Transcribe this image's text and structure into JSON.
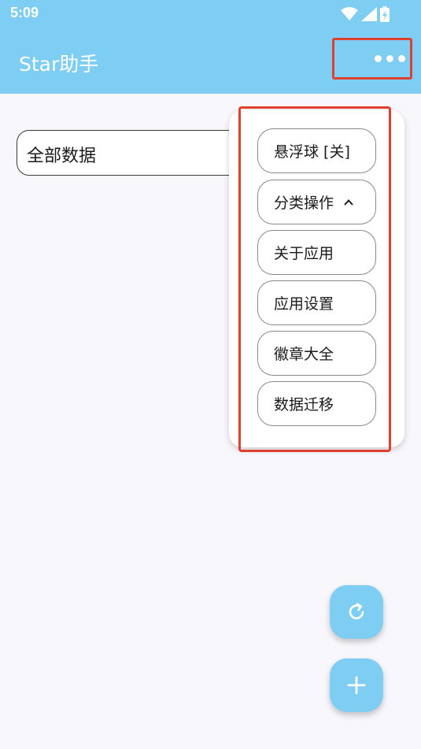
{
  "status_bar": {
    "time": "5:09",
    "icons": [
      "wifi-icon",
      "signal-icon",
      "battery-charging-icon"
    ]
  },
  "app_bar": {
    "title": "Star助手",
    "more_icon": "more-horizontal-icon"
  },
  "filter": {
    "label": "全部数据"
  },
  "menu": {
    "items": [
      {
        "label": "悬浮球 [关]"
      },
      {
        "label": "分类操作",
        "icon": "chevron-up-icon"
      },
      {
        "label": "关于应用"
      },
      {
        "label": "应用设置"
      },
      {
        "label": "徽章大全"
      },
      {
        "label": "数据迁移"
      }
    ]
  },
  "fabs": [
    {
      "icon": "refresh-icon"
    },
    {
      "icon": "add-icon"
    }
  ],
  "colors": {
    "primary": "#7ecdf3",
    "highlight": "#e0402f",
    "background": "#f8f7fc"
  }
}
